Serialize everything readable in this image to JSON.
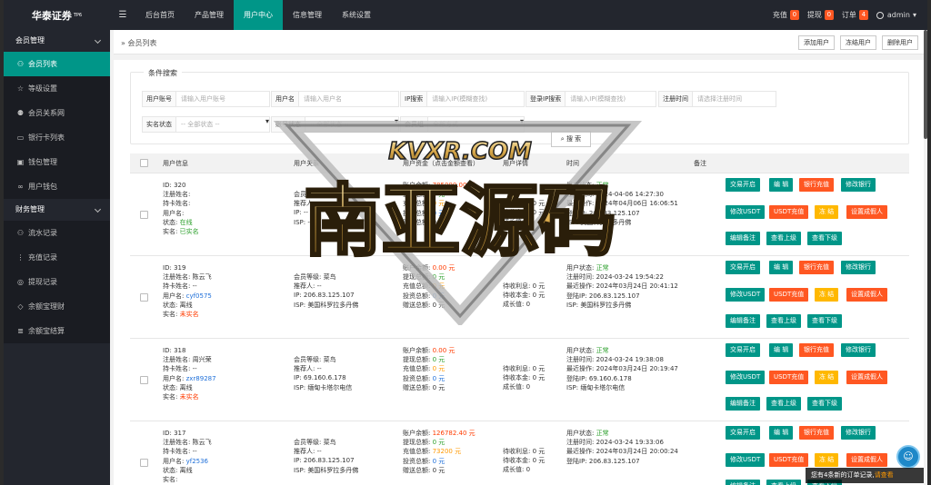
{
  "brand": {
    "name": "华泰证券",
    "sup": "TP6"
  },
  "nav": {
    "menu_icon": "menu-icon",
    "items": [
      "后台首页",
      "产品管理",
      "用户中心",
      "信息管理",
      "系统设置"
    ],
    "active": 2
  },
  "top_right": {
    "items": [
      {
        "label": "充值",
        "count": "0",
        "color": "#ff5722"
      },
      {
        "label": "提现",
        "count": "0",
        "color": "#ff5722"
      },
      {
        "label": "订单",
        "count": "4",
        "color": "#ff5722"
      }
    ],
    "admin": "admin"
  },
  "sidebar": {
    "groups": [
      {
        "title": "会员管理",
        "items": [
          {
            "label": "会员列表",
            "icon": "user-icon",
            "active": true
          },
          {
            "label": "等级设置",
            "icon": "star-icon"
          },
          {
            "label": "会员关系网",
            "icon": "users-icon"
          },
          {
            "label": "银行卡列表",
            "icon": "card-icon"
          },
          {
            "label": "钱包管理",
            "icon": "wallet-icon"
          },
          {
            "label": "用户钱包",
            "icon": "binoculars-icon"
          }
        ]
      },
      {
        "title": "财务管理",
        "items": [
          {
            "label": "流水记录",
            "icon": "user-icon"
          },
          {
            "label": "充值记录",
            "icon": "dots-icon"
          },
          {
            "label": "提现记录",
            "icon": "target-icon"
          },
          {
            "label": "余额宝理财",
            "icon": "diamond-icon"
          },
          {
            "label": "余额宝结算",
            "icon": "list-icon"
          }
        ]
      }
    ]
  },
  "breadcrumb": {
    "title": "会员列表",
    "buttons": [
      "添加用户",
      "冻结用户",
      "删除用户"
    ]
  },
  "filters": {
    "legend": "条件搜索",
    "fields": [
      {
        "label": "用户账号",
        "placeholder": "请输入用户账号"
      },
      {
        "label": "用户名",
        "placeholder": "请输入用户名"
      },
      {
        "label": "IP搜索",
        "placeholder": "请输入IP(模糊查找)"
      },
      {
        "label": "登录IP搜索",
        "placeholder": "请输入IP(模糊查找)"
      },
      {
        "label": "注册时间",
        "placeholder": "请选择注册时间"
      },
      {
        "label": "实名状态",
        "placeholder": "-- 全部状态 --"
      },
      {
        "label": "账号状态",
        "placeholder": "-- 全部状态 --"
      },
      {
        "label": "会员组",
        "placeholder": "全部方式"
      }
    ],
    "search_label": "搜 索"
  },
  "table": {
    "headers": [
      "用户信息",
      "用户关系",
      "用户资金（点击金额查看）",
      "用户详情",
      "时间",
      "备注"
    ],
    "actions": [
      "交易开启",
      "编 辑",
      "银行充值",
      "修改银行",
      "修改USDT",
      "USDT充值",
      "冻 结",
      "设置成假人",
      "编辑备注",
      "查看上级",
      "查看下级"
    ],
    "rows": [
      {
        "id": "320",
        "reg_name": "",
        "card_holder": "",
        "username": "",
        "status": "在线",
        "realname": "已实名",
        "level": "会员等级: 普通",
        "referrer": "推荐人: --",
        "ip": "IP: --",
        "isp": "ISP: --",
        "balance": "785000.00 元",
        "withdraw": "0 元",
        "recharge": "0 元",
        "invest": "0 元",
        "gift": "0 元",
        "unearn": "0 元",
        "uncap": "0 元",
        "growth": "0",
        "ustate": "正常",
        "reg_time": "2024-04-06 14:27:30",
        "last_op": "2024年04月06日 16:06:51",
        "login_ip": "206.83.125.107",
        "isp2": "ISP: 美国科罗拉多丹佛"
      },
      {
        "id": "319",
        "reg_name": "陈云飞",
        "card_holder": "--",
        "username": "cyf0575",
        "status": "离线",
        "realname": "未实名",
        "level": "会员等级: 菜鸟",
        "referrer": "推荐人: --",
        "ip": "IP: 206.83.125.107",
        "isp": "ISP: 美国科罗拉多丹佛",
        "balance": "0.00 元",
        "withdraw": "0 元",
        "recharge": "0 元",
        "invest": "0 元",
        "gift": "0 元",
        "unearn": "0 元",
        "uncap": "0 元",
        "growth": "0",
        "ustate": "正常",
        "reg_time": "2024-03-24 19:54:22",
        "last_op": "2024年03月24日 20:41:12",
        "login_ip": "206.83.125.107",
        "isp2": "ISP: 美国科罗拉多丹佛"
      },
      {
        "id": "318",
        "reg_name": "周兴荣",
        "card_holder": "--",
        "username": "zxr89287",
        "status": "离线",
        "realname": "未实名",
        "level": "会员等级: 菜鸟",
        "referrer": "推荐人: --",
        "ip": "IP: 69.160.6.178",
        "isp": "ISP: 缅甸卡塔尔电信",
        "balance": "0.00 元",
        "withdraw": "0 元",
        "recharge": "0 元",
        "invest": "0 元",
        "gift": "0 元",
        "unearn": "0 元",
        "uncap": "0 元",
        "growth": "0",
        "ustate": "正常",
        "reg_time": "2024-03-24 19:38:08",
        "last_op": "2024年03月24日 20:19:47",
        "login_ip": "69.160.6.178",
        "isp2": "ISP: 缅甸卡塔尔电信"
      },
      {
        "id": "317",
        "reg_name": "陈云飞",
        "card_holder": "--",
        "username": "yf2536",
        "status": "离线",
        "realname": "",
        "level": "会员等级: 菜鸟",
        "referrer": "推荐人: --",
        "ip": "IP: 206.83.125.107",
        "isp": "ISP: 美国科罗拉多丹佛",
        "balance": "126782.40 元",
        "withdraw": "0 元",
        "recharge": "73200 元",
        "invest": "0 元",
        "gift": "0 元",
        "unearn": "0 元",
        "uncap": "0 元",
        "growth": "0",
        "ustate": "正常",
        "reg_time": "2024-03-24 19:33:06",
        "last_op": "2024年03月24日 20:00:24",
        "login_ip": "206.83.125.107",
        "isp2": ""
      }
    ],
    "labels": {
      "id": "ID:",
      "reg_name": "注册姓名:",
      "card_holder": "持卡姓名:",
      "username": "用户名:",
      "status": "状态:",
      "realname": "实名:",
      "balance": "账户余额:",
      "withdraw": "提现总额:",
      "recharge": "充值总额:",
      "invest": "投资总额:",
      "gift": "赠送总额:",
      "unearn": "待收利息:",
      "uncap": "待收本金:",
      "growth": "成长值:",
      "ustate": "用户状态:",
      "reg_time": "注册时间:",
      "last_op": "最近操作:",
      "login_ip": "登陆IP:"
    }
  },
  "notice": {
    "text": "您有4条新的订单记录,",
    "link": "请查看"
  },
  "watermark": {
    "top": "KVXR.COM",
    "main": "南亚源码"
  }
}
